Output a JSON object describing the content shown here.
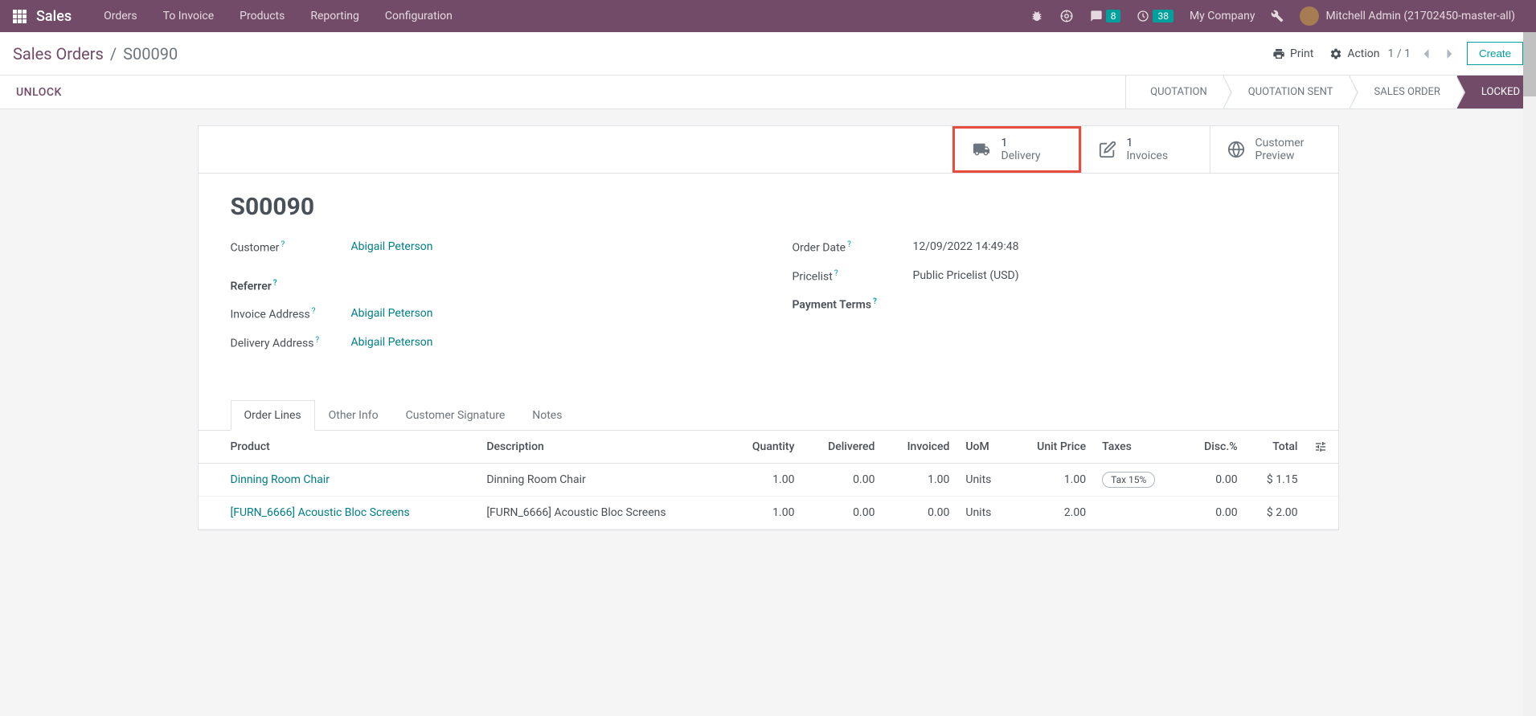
{
  "topbar": {
    "brand": "Sales",
    "nav": [
      "Orders",
      "To Invoice",
      "Products",
      "Reporting",
      "Configuration"
    ],
    "messages_count": "8",
    "activities_count": "38",
    "company": "My Company",
    "user": "Mitchell Admin (21702450-master-all)"
  },
  "breadcrumb": {
    "parent": "Sales Orders",
    "current": "S00090"
  },
  "controls": {
    "print": "Print",
    "action": "Action",
    "pager": "1 / 1",
    "create": "Create"
  },
  "statusbar": {
    "unlock": "UNLOCK",
    "stages": [
      "QUOTATION",
      "QUOTATION SENT",
      "SALES ORDER",
      "LOCKED"
    ]
  },
  "stat_buttons": {
    "delivery": {
      "count": "1",
      "label": "Delivery"
    },
    "invoices": {
      "count": "1",
      "label": "Invoices"
    },
    "preview": {
      "line1": "Customer",
      "line2": "Preview"
    }
  },
  "record": {
    "title": "S00090",
    "customer_label": "Customer",
    "customer": "Abigail Peterson",
    "referrer_label": "Referrer",
    "invoice_addr_label": "Invoice Address",
    "invoice_addr": "Abigail Peterson",
    "delivery_addr_label": "Delivery Address",
    "delivery_addr": "Abigail Peterson",
    "order_date_label": "Order Date",
    "order_date": "12/09/2022 14:49:48",
    "pricelist_label": "Pricelist",
    "pricelist": "Public Pricelist (USD)",
    "payment_terms_label": "Payment Terms"
  },
  "tabs": [
    "Order Lines",
    "Other Info",
    "Customer Signature",
    "Notes"
  ],
  "table": {
    "headers": {
      "product": "Product",
      "description": "Description",
      "quantity": "Quantity",
      "delivered": "Delivered",
      "invoiced": "Invoiced",
      "uom": "UoM",
      "unit_price": "Unit Price",
      "taxes": "Taxes",
      "disc": "Disc.%",
      "total": "Total"
    },
    "rows": [
      {
        "product": "Dinning Room Chair",
        "description": "Dinning Room Chair",
        "quantity": "1.00",
        "delivered": "0.00",
        "invoiced": "1.00",
        "uom": "Units",
        "unit_price": "1.00",
        "tax": "Tax 15%",
        "disc": "0.00",
        "total": "$ 1.15"
      },
      {
        "product": "[FURN_6666] Acoustic Bloc Screens",
        "description": "[FURN_6666] Acoustic Bloc Screens",
        "quantity": "1.00",
        "delivered": "0.00",
        "invoiced": "0.00",
        "uom": "Units",
        "unit_price": "2.00",
        "tax": "",
        "disc": "0.00",
        "total": "$ 2.00"
      }
    ]
  }
}
